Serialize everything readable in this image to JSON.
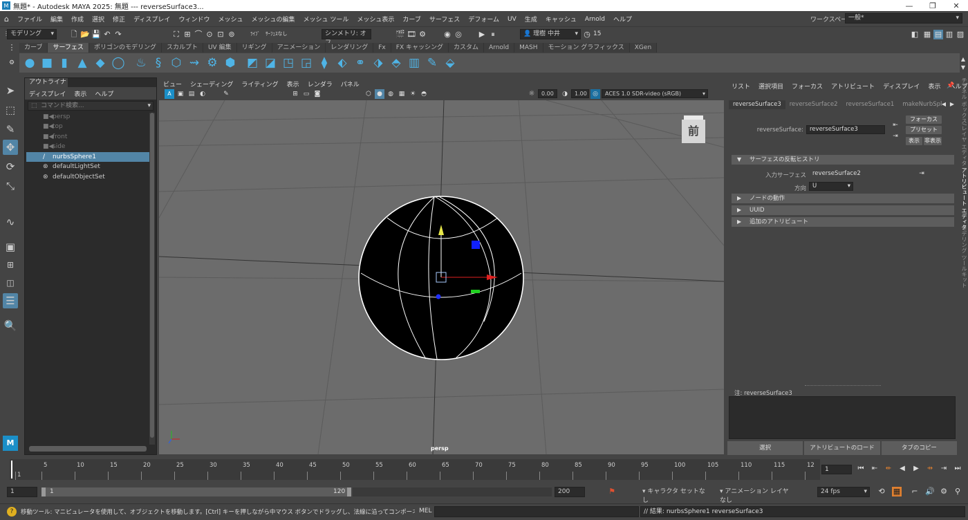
{
  "title_bar": {
    "app_icon": "M",
    "title": "無題* - Autodesk MAYA 2025: 無題   ---   reverseSurface3...",
    "minimize": "—",
    "maximize": "❐",
    "close": "✕"
  },
  "menu_bar": {
    "items": [
      "ファイル",
      "編集",
      "作成",
      "選択",
      "修正",
      "ディスプレイ",
      "ウィンドウ",
      "メッシュ",
      "メッシュの編集",
      "メッシュ ツール",
      "メッシュ表示",
      "カーブ",
      "サーフェス",
      "デフォーム",
      "UV",
      "生成",
      "キャッシュ",
      "Arnold",
      "ヘルプ"
    ],
    "workspace_label": "ワークスペース:",
    "workspace_value": "一般*"
  },
  "status_line": {
    "mode": "モデリング",
    "live_label": "ﾗｲﾌﾞ",
    "live_value": "ｻｰﾌｪｽなし",
    "symmetry": "シンメトリ: オフ",
    "user": "理樹 中井",
    "credits": "15"
  },
  "shelf": {
    "tabs": [
      "カーブ",
      "サーフェス",
      "ポリゴンのモデリング",
      "スカルプト",
      "UV 編集",
      "リギング",
      "アニメーション",
      "レンダリング",
      "Fx",
      "FX キャッシング",
      "カスタム",
      "Arnold",
      "MASH",
      "モーション グラフィックス",
      "XGen"
    ],
    "active_tab": "サーフェス"
  },
  "outliner": {
    "tab": "アウトライナ",
    "menu": [
      "ディスプレイ",
      "表示",
      "ヘルプ"
    ],
    "search_placeholder": "コマンド検索...",
    "items": [
      {
        "label": "persp",
        "kind": "camera",
        "state": "dim"
      },
      {
        "label": "top",
        "kind": "camera",
        "state": "dim"
      },
      {
        "label": "front",
        "kind": "camera",
        "state": "dim"
      },
      {
        "label": "side",
        "kind": "camera",
        "state": "dim"
      },
      {
        "label": "nurbsSphere1",
        "kind": "nurbs",
        "state": "selected"
      },
      {
        "label": "defaultLightSet",
        "kind": "set",
        "state": "normal"
      },
      {
        "label": "defaultObjectSet",
        "kind": "set",
        "state": "normal"
      }
    ]
  },
  "viewport": {
    "menu": [
      "ビュー",
      "シェーディング",
      "ライティング",
      "表示",
      "レンダラ",
      "パネル"
    ],
    "exposure": "0.00",
    "gamma": "1.00",
    "color_space": "ACES 1.0 SDR-video (sRGB)",
    "camera_label": "persp",
    "viewcube_face": "前",
    "background_color": "#6c6c6c"
  },
  "attribute_editor": {
    "menu": [
      "リスト",
      "選択項目",
      "フォーカス",
      "アトリビュート",
      "ディスプレイ",
      "表示",
      "ヘルプ"
    ],
    "tabs": [
      "reverseSurface3",
      "reverseSurface2",
      "reverseSurface1",
      "makeNurbSpl"
    ],
    "node_type_label": "reverseSurface:",
    "node_name": "reverseSurface3",
    "focus_button": "フォーカス",
    "presets_button": "プリセット",
    "show_button": "表示",
    "hide_button": "非表示",
    "section_main": "サーフェスの反転ヒストリ",
    "input_surface_label": "入力サーフェス",
    "input_surface_value": "reverseSurface2",
    "direction_label": "方向",
    "direction_value": "U",
    "sections": [
      "ノードの動作",
      "UUID",
      "追加のアトリビュート"
    ],
    "notes_label": "注:  reverseSurface3",
    "bottom_buttons": [
      "選択",
      "アトリビュートのロード",
      "タブのコピー"
    ]
  },
  "side_tabs": [
    "チャネル ボックス/レイヤ エディタ",
    "アトリビュート エディタ",
    "モデリング ツールキット"
  ],
  "time_slider": {
    "labels": [
      "1",
      "5",
      "10",
      "15",
      "20",
      "25",
      "30",
      "35",
      "40",
      "45",
      "50",
      "55",
      "60",
      "65",
      "70",
      "75",
      "80",
      "85",
      "90",
      "95",
      "100",
      "105",
      "110",
      "115",
      "12"
    ],
    "current_frame": "1"
  },
  "range_slider": {
    "start": "1",
    "range_start": "1",
    "range_end": "120",
    "end": "200",
    "character_set": "キャラクタ セットなし",
    "anim_layer": "アニメーション レイヤなし",
    "fps": "24 fps"
  },
  "command_line": {
    "help": "移動ツール: マニピュレータを使用して、オブジェクトを移動します。[Ctrl] キーを押しながら中マウス ボタンでドラッグし、法線に沿ってコンポーネントを移動します。[Shift] キーを押しながらマニピ",
    "mel_label": "MEL",
    "result": "// 結果: nurbsSphere1 reverseSurface3"
  }
}
